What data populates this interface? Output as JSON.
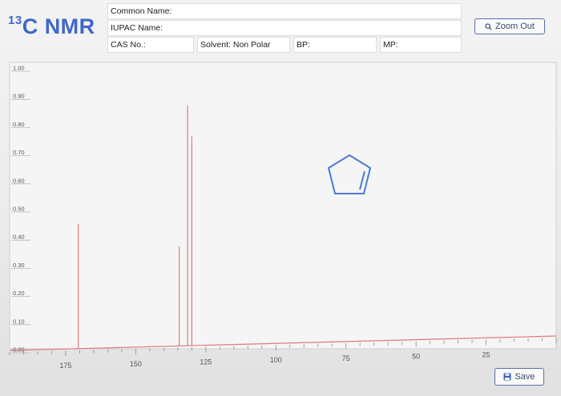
{
  "header": {
    "title_main": "C NMR",
    "title_isotope": "13",
    "common_name_label": "Common Name:",
    "iupac_name_label": "IUPAC Name:",
    "cas_label": "CAS No.:",
    "solvent_label": "Solvent: Non Polar",
    "bp_label": "BP:",
    "mp_label": "MP:"
  },
  "toolbar": {
    "zoom_out_label": "Zoom Out",
    "zoom_out_icon": "magnifier-icon",
    "save_label": "Save",
    "save_icon": "floppy-disk-icon"
  },
  "colors": {
    "title": "#3f67c8",
    "peak": "#e07a7a",
    "baseline": "#e07a7a",
    "molecule": "#4a7bd6"
  },
  "chart_data": {
    "type": "bar",
    "xlim": [
      195,
      0
    ],
    "ylim": [
      0,
      1.0
    ],
    "x_ticks": [
      175,
      150,
      125,
      100,
      75,
      50,
      25
    ],
    "y_ticks": [
      "0.00",
      "0.10",
      "0.20",
      "0.30",
      "0.40",
      "0.50",
      "0.60",
      "0.70",
      "0.80",
      "0.90",
      "1.00"
    ],
    "y_tick_values": [
      0,
      0.1,
      0.2,
      0.3,
      0.4,
      0.5,
      0.6,
      0.7,
      0.8,
      0.9,
      1.0
    ],
    "grid": false,
    "series": [
      {
        "peaks": [
          {
            "x": 170.5,
            "y": 0.45
          },
          {
            "x": 134.5,
            "y": 0.37
          },
          {
            "x": 131.5,
            "y": 0.87
          },
          {
            "x": 130.0,
            "y": 0.76
          }
        ]
      }
    ],
    "structure": "cyclopentene"
  }
}
